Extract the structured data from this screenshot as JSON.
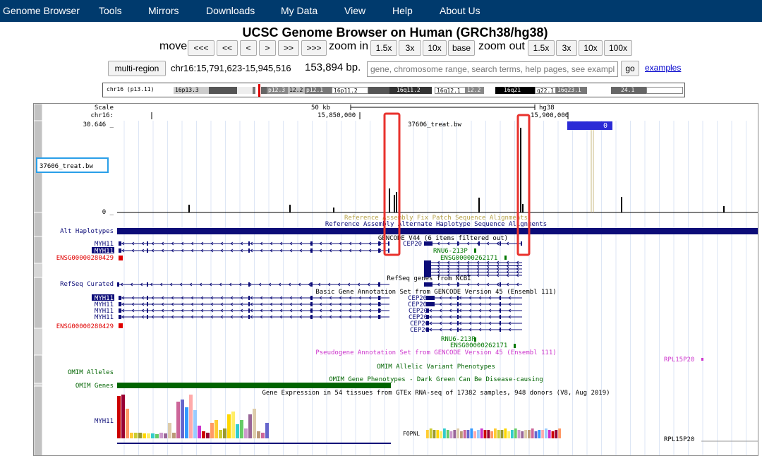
{
  "nav": {
    "items": [
      "Genome Browser",
      "Tools",
      "Mirrors",
      "Downloads",
      "My Data",
      "View",
      "Help",
      "About Us"
    ]
  },
  "title": "UCSC Genome Browser on Human (GRCh38/hg38)",
  "controls": {
    "move_label": "move",
    "move_buttons": [
      "<<<",
      "<<",
      "<",
      ">",
      ">>",
      ">>>"
    ],
    "zoom_in_label": "zoom in",
    "zoom_in_buttons": [
      "1.5x",
      "3x",
      "10x",
      "base"
    ],
    "zoom_out_label": "zoom out",
    "zoom_out_buttons": [
      "1.5x",
      "3x",
      "10x",
      "100x"
    ],
    "multi_region": "multi-region",
    "position": "chr16:15,791,623-15,945,516",
    "size": "153,894 bp.",
    "search_placeholder": "gene, chromosome range, search terms, help pages, see examples",
    "go": "go",
    "examples": "examples"
  },
  "ideogram": {
    "label": "chr16 (p13.11)",
    "bands": [
      "16p13.3",
      "p12.3",
      "12.2",
      "p12.1",
      "16p11.2",
      "16q11.2",
      "16q12.1",
      "12.2",
      "16q21",
      "q22.1",
      "16q23.1",
      "24.1"
    ]
  },
  "tracks": {
    "scale_label": "Scale",
    "chrom_label": "chr16:",
    "scale_bar": "50 kb",
    "assembly": "hg38",
    "pos_15850": "15,850,000",
    "pos_15900": "15,900,000",
    "bw_max": "30.646 _",
    "bw_min": "0 _",
    "bw_title": "37606_treat.bw",
    "bw_name": "37606_treat.bw",
    "bw_tooltip": "0",
    "fix_patch": "Reference Assembly Fix Patch Sequence Alignments",
    "alt_hap_title": "Reference Assembly Alternate Haplotype Sequence Alignments",
    "alt_hap": "Alt Haplotypes",
    "gencode_title": "GENCODE V44 (6 items filtered out)",
    "gene_myh11": "MYH11",
    "gene_ensg": "ENSG00000280429",
    "gene_cep20": "CEP20",
    "gene_rnu6": "RNU6-213P",
    "gene_ensg2": "ENSG00000262171",
    "refseq_title": "RefSeq genes from NCBI",
    "refseq_curated": "RefSeq Curated",
    "basic_title": "Basic Gene Annotation Set from GENCODE Version 45 (Ensembl 111)",
    "pseudo_title": "Pseudogene Annotation Set from GENCODE Version 45 (Ensembl 111)",
    "rpl": "RPL15P20",
    "omim_allelic_title": "OMIM Allelic Variant Phenotypes",
    "omim_alleles": "OMIM Alleles",
    "omim_pheno_title": "OMIM Gene Phenotypes - Dark Green Can Be Disease-causing",
    "omim_genes": "OMIM Genes",
    "gtex_title": "Gene Expression in 54 tissues from GTEx RNA-seq of 17382 samples, 948 donors (V8, Aug 2019)",
    "fopnl": "FOPNL",
    "gtex_rpl": "RPL15P20"
  },
  "colors": {
    "nav_bg": "#003a6d",
    "highlight_red": "#e8322d",
    "highlight_blue": "#2a9fe8",
    "dark_navy": "#0c0c78",
    "green": "#006400",
    "ensg_red": "#e00000",
    "magenta": "#cc33cc"
  }
}
